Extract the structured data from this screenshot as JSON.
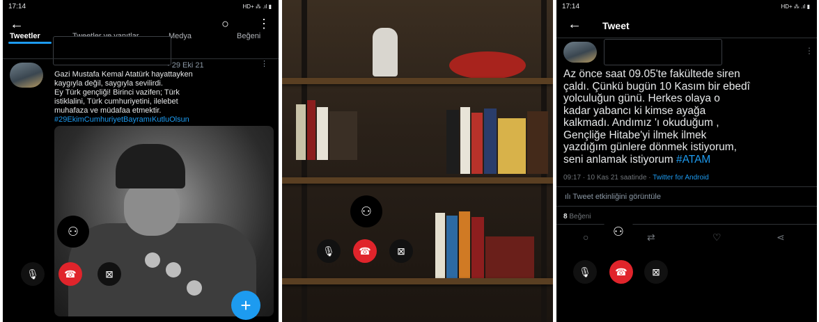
{
  "left_panel": {
    "status": {
      "time": "17:14",
      "icons": "HD+ ⁂ .ıl ▮"
    },
    "header": {
      "back_icon": "arrow-left-icon",
      "search_icon": "search-icon",
      "more_icon": "more-vertical-icon"
    },
    "tabs": [
      "Tweetler",
      "Tweetler ve yanıtlar",
      "Medya",
      "Beğeni"
    ],
    "tweet": {
      "date": "· 29 Eki 21",
      "lines": [
        "Gazi Mustafa Kemal Atatürk hayattayken",
        "kaygıyla değil, saygıyla sevilirdi.",
        "Ey Türk gençliği! Birinci vazifen; Türk",
        "istiklalini, Türk cumhuriyetini, ilelebet",
        "muhafaza ve müdafaa etmektir."
      ],
      "hashtag": "#29EkimCumhuriyetBayramıKutluOlsun"
    },
    "fab_label": "+"
  },
  "call_icons": {
    "person": "person-icon",
    "mic": "microphone-icon",
    "end": "end-call-icon",
    "video_off": "video-off-icon"
  },
  "right_panel": {
    "status": {
      "time": "17:14",
      "icons": "HD+ ⁂ .ıl ▮"
    },
    "title": "Tweet",
    "text_lines": [
      "Az önce saat 09.05'te fakültede siren",
      "çaldı. Çünkü bugün 10 Kasım bir ebedî",
      "yolculuğun günü. Herkes olaya o",
      "kadar yabancı ki kimse ayağa",
      "kalkmadı. Andımız 'ı okuduğum ,",
      "Gençliğe Hitabe'yi ilmek ilmek",
      "yazdığım günlere dönmek istiyorum,",
      "seni anlamak istiyorum"
    ],
    "hashtag": "#ATAM",
    "meta_time": "09:17 · 10 Kas 21 saatinde · ",
    "meta_source": "Twitter for Android",
    "activity": "ılı Tweet etkinliğini görüntüle",
    "likes_count": "8",
    "likes_label": "Beğeni"
  },
  "colors": {
    "accent": "#1d9bf0",
    "end_call": "#e0242b",
    "background": "#000000"
  }
}
